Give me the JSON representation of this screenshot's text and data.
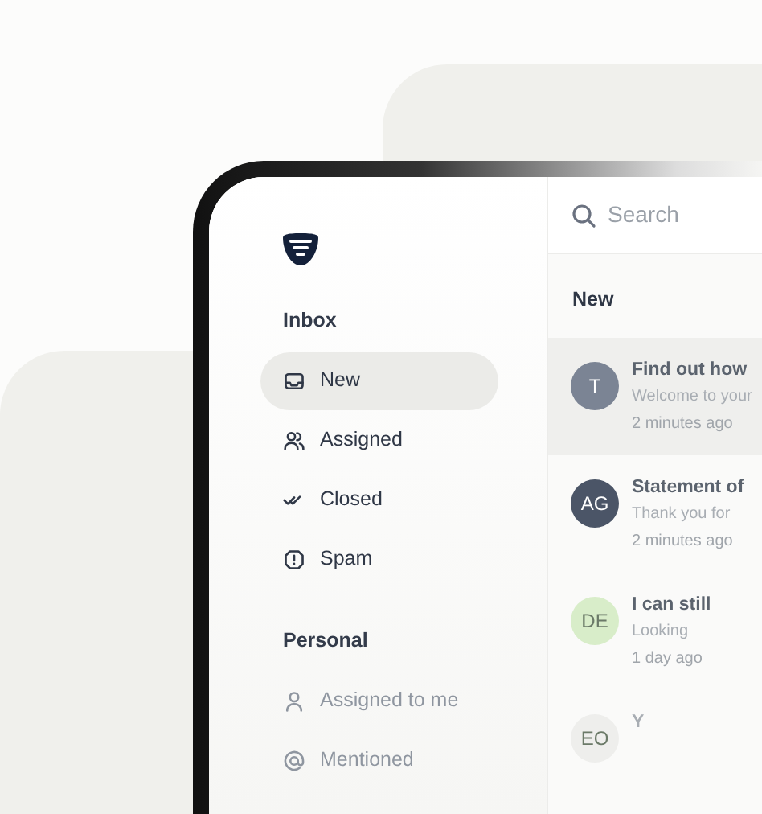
{
  "sidebar": {
    "sections": [
      {
        "title": "Inbox",
        "items": [
          {
            "label": "New",
            "selected": true
          },
          {
            "label": "Assigned",
            "selected": false
          },
          {
            "label": "Closed",
            "selected": false
          },
          {
            "label": "Spam",
            "selected": false
          }
        ]
      },
      {
        "title": "Personal",
        "items": [
          {
            "label": "Assigned to me",
            "selected": false
          },
          {
            "label": "Mentioned",
            "selected": false
          }
        ]
      }
    ]
  },
  "search": {
    "placeholder": "Search"
  },
  "list": {
    "heading": "New",
    "messages": [
      {
        "initials": "T",
        "color": "#7b8494",
        "title": "Find out how",
        "preview": "Welcome to your",
        "time": "2 minutes ago",
        "selected": true
      },
      {
        "initials": "AG",
        "color": "#4b5567",
        "title": "Statement of",
        "preview": "Thank you for",
        "time": "2 minutes ago",
        "selected": false
      },
      {
        "initials": "DE",
        "color": "#d8edc9",
        "title": "I can still",
        "preview": "Looking",
        "time": "1 day ago",
        "selected": false
      },
      {
        "initials": "EO",
        "color": "#eeeeec",
        "title": "Y",
        "selected": false
      }
    ]
  }
}
